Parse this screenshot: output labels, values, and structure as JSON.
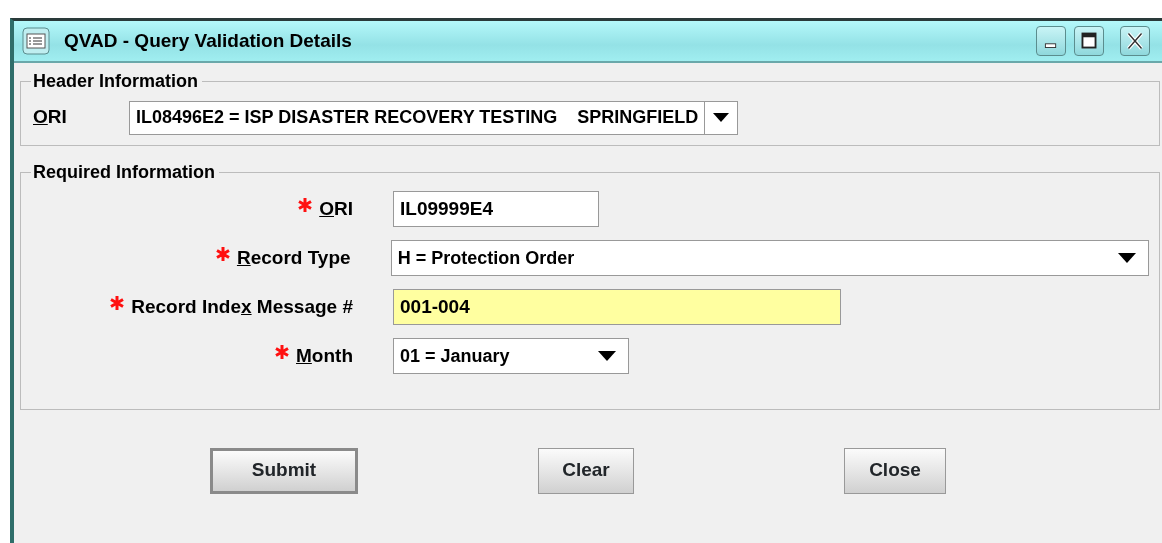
{
  "window": {
    "title": "QVAD - Query Validation Details"
  },
  "header_section": {
    "title": "Header Information",
    "ori": {
      "label": {
        "key": "O",
        "after": "RI"
      },
      "value": "IL08496E2 = ISP DISASTER RECOVERY TESTING    SPRINGFIELD"
    }
  },
  "required_section": {
    "title": "Required Information",
    "fields": [
      {
        "kind": "text",
        "required": true,
        "label": {
          "key": "O",
          "after": "RI"
        },
        "value": "IL09999E4",
        "highlighted": false
      },
      {
        "kind": "select",
        "required": true,
        "label": {
          "key": "R",
          "after": "ecord Type"
        },
        "value": "H = Protection Order",
        "highlighted": false
      },
      {
        "kind": "text",
        "required": true,
        "label": {
          "before": "Record Inde",
          "key": "x",
          "after": " Message #"
        },
        "value": "001-004",
        "highlighted": true
      },
      {
        "kind": "select",
        "required": true,
        "label": {
          "key": "M",
          "after": "onth"
        },
        "value": "01 = January",
        "highlighted": false
      }
    ]
  },
  "buttons": [
    {
      "label": "Submit",
      "default": true
    },
    {
      "label": "Clear",
      "default": false
    },
    {
      "label": "Close",
      "default": false
    }
  ]
}
